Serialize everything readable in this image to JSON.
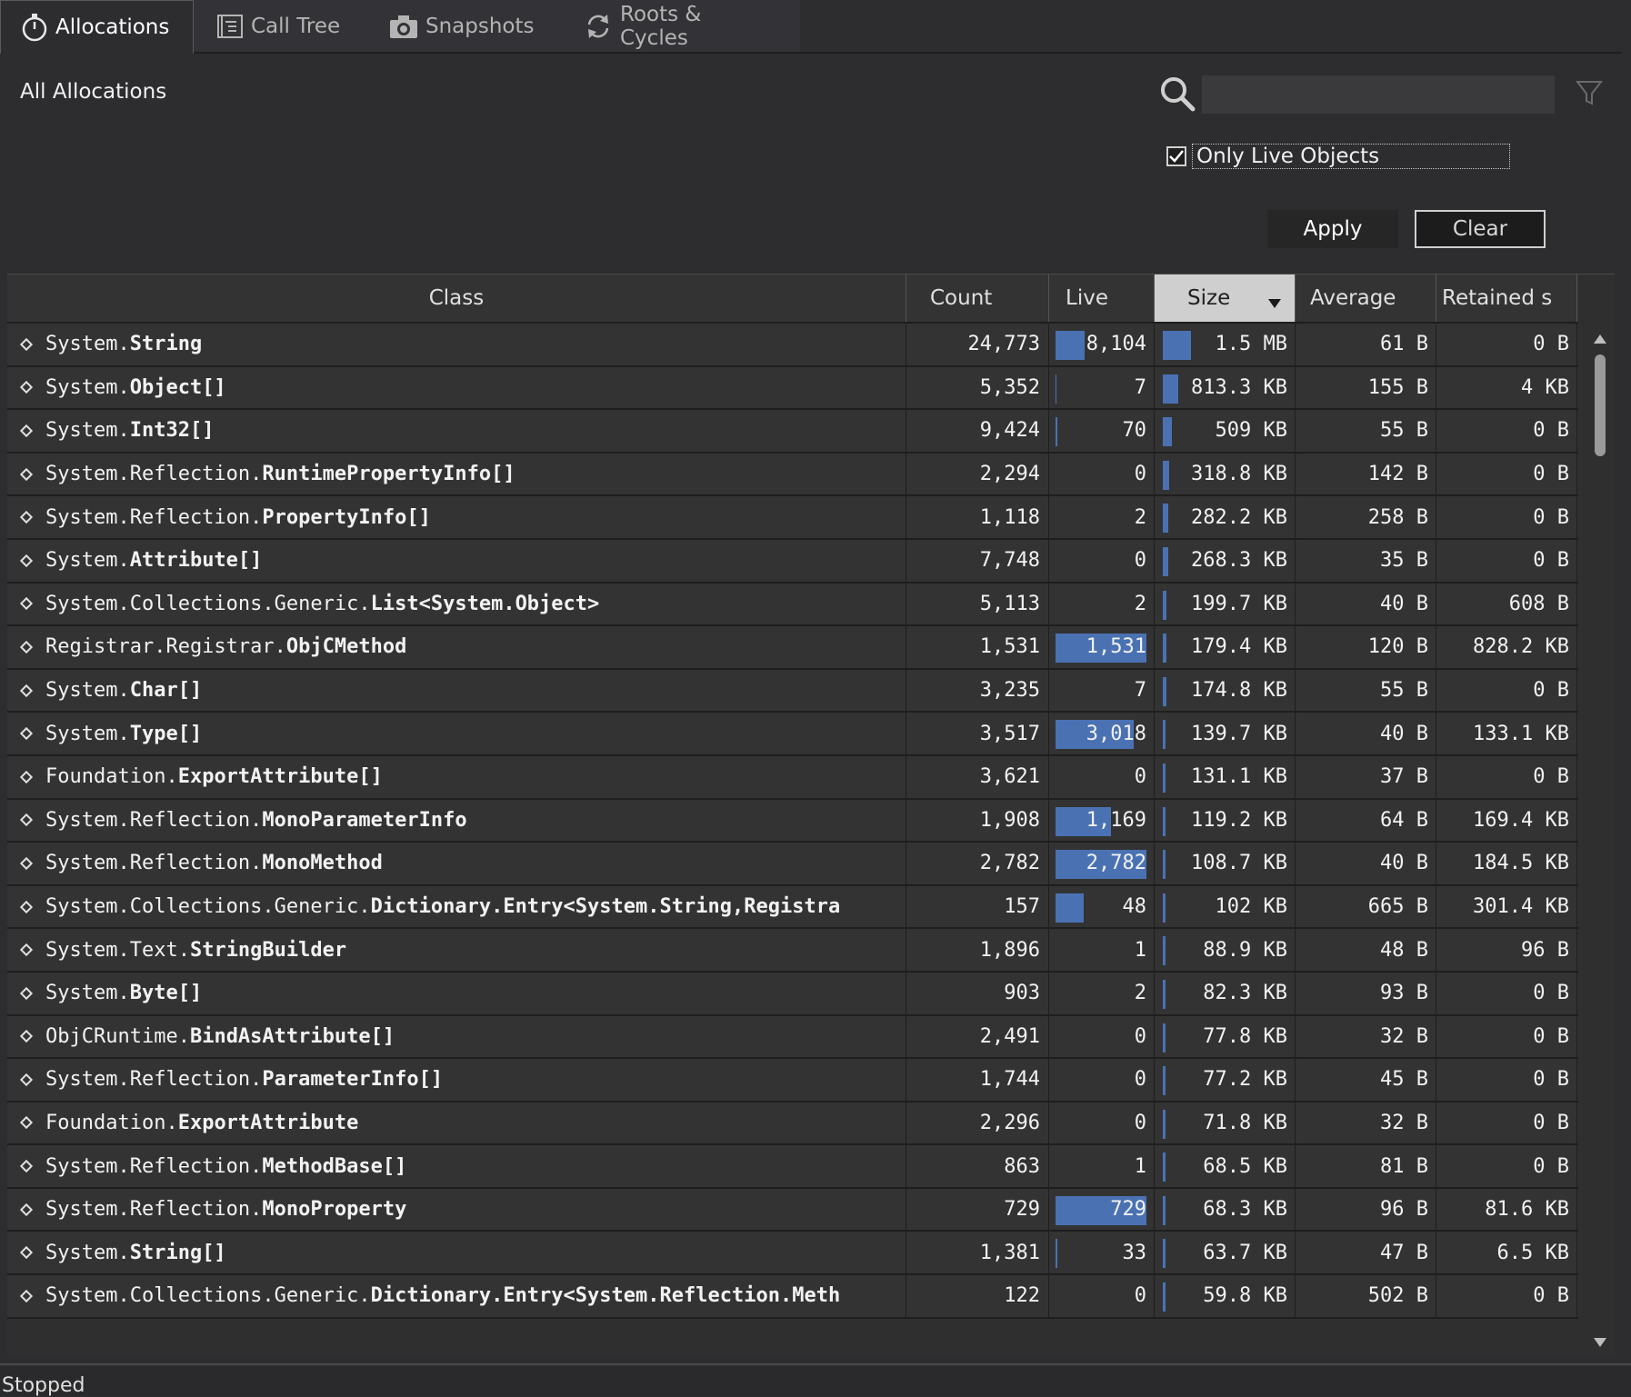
{
  "tabs": [
    {
      "label": "Allocations",
      "icon": "stopwatch-icon",
      "active": true
    },
    {
      "label": "Call Tree",
      "icon": "call-tree-icon",
      "active": false
    },
    {
      "label": "Snapshots",
      "icon": "camera-icon",
      "active": false
    },
    {
      "label": "Roots & Cycles",
      "icon": "refresh-icon",
      "active": false
    }
  ],
  "filter": {
    "title": "All Allocations",
    "search_value": "",
    "only_live_label": "Only Live Objects",
    "only_live_checked": true,
    "apply_label": "Apply",
    "clear_label": "Clear"
  },
  "table": {
    "columns": {
      "class": "Class",
      "count": "Count",
      "live": "Live",
      "size": "Size",
      "average": "Average",
      "retained": "Retained s"
    },
    "sorted_column": "size",
    "sort_direction": "descending",
    "rows": [
      {
        "ns": "System.",
        "name": "String",
        "count": "24,773",
        "live": "8,104",
        "live_fraction": 0.32,
        "size": "1.5 MB",
        "size_fraction": 0.22,
        "average": "61 B",
        "retained": "0 B"
      },
      {
        "ns": "System.",
        "name": "Object[]",
        "count": "5,352",
        "live": "7",
        "live_fraction": 0.0,
        "size": "813.3 KB",
        "size_fraction": 0.12,
        "average": "155 B",
        "retained": "4 KB"
      },
      {
        "ns": "System.",
        "name": "Int32[]",
        "count": "9,424",
        "live": "70",
        "live_fraction": 0.01,
        "size": "509 KB",
        "size_fraction": 0.07,
        "average": "55 B",
        "retained": "0 B"
      },
      {
        "ns": "System.Reflection.",
        "name": "RuntimePropertyInfo[]",
        "count": "2,294",
        "live": "0",
        "live_fraction": 0.0,
        "size": "318.8 KB",
        "size_fraction": 0.05,
        "average": "142 B",
        "retained": "0 B"
      },
      {
        "ns": "System.Reflection.",
        "name": "PropertyInfo[]",
        "count": "1,118",
        "live": "2",
        "live_fraction": 0.0,
        "size": "282.2 KB",
        "size_fraction": 0.04,
        "average": "258 B",
        "retained": "0 B"
      },
      {
        "ns": "System.",
        "name": "Attribute[]",
        "count": "7,748",
        "live": "0",
        "live_fraction": 0.0,
        "size": "268.3 KB",
        "size_fraction": 0.04,
        "average": "35 B",
        "retained": "0 B"
      },
      {
        "ns": "System.Collections.Generic.",
        "name": "List<System.Object>",
        "count": "5,113",
        "live": "2",
        "live_fraction": 0.0,
        "size": "199.7 KB",
        "size_fraction": 0.03,
        "average": "40 B",
        "retained": "608 B"
      },
      {
        "ns": "Registrar.Registrar.",
        "name": "ObjCMethod",
        "count": "1,531",
        "live": "1,531",
        "live_fraction": 1.0,
        "size": "179.4 KB",
        "size_fraction": 0.03,
        "average": "120 B",
        "retained": "828.2 KB"
      },
      {
        "ns": "System.",
        "name": "Char[]",
        "count": "3,235",
        "live": "7",
        "live_fraction": 0.0,
        "size": "174.8 KB",
        "size_fraction": 0.03,
        "average": "55 B",
        "retained": "0 B"
      },
      {
        "ns": "System.",
        "name": "Type[]",
        "count": "3,517",
        "live": "3,018",
        "live_fraction": 0.86,
        "size": "139.7 KB",
        "size_fraction": 0.02,
        "average": "40 B",
        "retained": "133.1 KB"
      },
      {
        "ns": "Foundation.",
        "name": "ExportAttribute[]",
        "count": "3,621",
        "live": "0",
        "live_fraction": 0.0,
        "size": "131.1 KB",
        "size_fraction": 0.02,
        "average": "37 B",
        "retained": "0 B"
      },
      {
        "ns": "System.Reflection.",
        "name": "MonoParameterInfo",
        "count": "1,908",
        "live": "1,169",
        "live_fraction": 0.61,
        "size": "119.2 KB",
        "size_fraction": 0.02,
        "average": "64 B",
        "retained": "169.4 KB"
      },
      {
        "ns": "System.Reflection.",
        "name": "MonoMethod",
        "count": "2,782",
        "live": "2,782",
        "live_fraction": 1.0,
        "size": "108.7 KB",
        "size_fraction": 0.02,
        "average": "40 B",
        "retained": "184.5 KB"
      },
      {
        "ns": "System.Collections.Generic.",
        "name": "Dictionary.Entry<System.String,Registra",
        "count": "157",
        "live": "48",
        "live_fraction": 0.31,
        "size": "102 KB",
        "size_fraction": 0.01,
        "average": "665 B",
        "retained": "301.4 KB"
      },
      {
        "ns": "System.Text.",
        "name": "StringBuilder",
        "count": "1,896",
        "live": "1",
        "live_fraction": 0.0,
        "size": "88.9 KB",
        "size_fraction": 0.01,
        "average": "48 B",
        "retained": "96 B"
      },
      {
        "ns": "System.",
        "name": "Byte[]",
        "count": "903",
        "live": "2",
        "live_fraction": 0.0,
        "size": "82.3 KB",
        "size_fraction": 0.01,
        "average": "93 B",
        "retained": "0 B"
      },
      {
        "ns": "ObjCRuntime.",
        "name": "BindAsAttribute[]",
        "count": "2,491",
        "live": "0",
        "live_fraction": 0.0,
        "size": "77.8 KB",
        "size_fraction": 0.01,
        "average": "32 B",
        "retained": "0 B"
      },
      {
        "ns": "System.Reflection.",
        "name": "ParameterInfo[]",
        "count": "1,744",
        "live": "0",
        "live_fraction": 0.0,
        "size": "77.2 KB",
        "size_fraction": 0.01,
        "average": "45 B",
        "retained": "0 B"
      },
      {
        "ns": "Foundation.",
        "name": "ExportAttribute",
        "count": "2,296",
        "live": "0",
        "live_fraction": 0.0,
        "size": "71.8 KB",
        "size_fraction": 0.01,
        "average": "32 B",
        "retained": "0 B"
      },
      {
        "ns": "System.Reflection.",
        "name": "MethodBase[]",
        "count": "863",
        "live": "1",
        "live_fraction": 0.0,
        "size": "68.5 KB",
        "size_fraction": 0.01,
        "average": "81 B",
        "retained": "0 B"
      },
      {
        "ns": "System.Reflection.",
        "name": "MonoProperty",
        "count": "729",
        "live": "729",
        "live_fraction": 1.0,
        "size": "68.3 KB",
        "size_fraction": 0.01,
        "average": "96 B",
        "retained": "81.6 KB"
      },
      {
        "ns": "System.",
        "name": "String[]",
        "count": "1,381",
        "live": "33",
        "live_fraction": 0.02,
        "size": "63.7 KB",
        "size_fraction": 0.01,
        "average": "47 B",
        "retained": "6.5 KB"
      },
      {
        "ns": "System.Collections.Generic.",
        "name": "Dictionary.Entry<System.Reflection.Meth",
        "count": "122",
        "live": "0",
        "live_fraction": 0.0,
        "size": "59.8 KB",
        "size_fraction": 0.01,
        "average": "502 B",
        "retained": "0 B"
      }
    ]
  },
  "status": "Stopped",
  "colors": {
    "background": "#2d2d30",
    "row": "#333333",
    "bar": "#4a72b3",
    "sorted_header": "#cfcfcf"
  }
}
